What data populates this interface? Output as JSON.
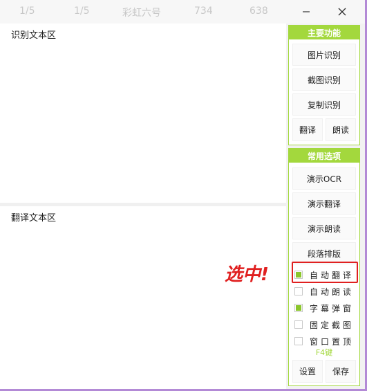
{
  "titlebar": {
    "items": [
      "1/5",
      "1/5",
      "彩虹六号",
      "734",
      "638"
    ],
    "minimize_icon": "minimize-icon",
    "close_icon": "close-icon"
  },
  "recognition_area": {
    "label": "识别文本区"
  },
  "translation_area": {
    "label": "翻译文本区"
  },
  "main_panel": {
    "title": "主要功能",
    "buttons": [
      "图片识别",
      "截图识别",
      "复制识别"
    ],
    "translate": "翻译",
    "read": "朗读"
  },
  "options_panel": {
    "title": "常用选项",
    "buttons": [
      "演示OCR",
      "演示翻译",
      "演示朗读",
      "段落排版"
    ],
    "checkboxes": [
      {
        "label": "自动翻译",
        "checked": true
      },
      {
        "label": "自动朗读",
        "checked": false
      },
      {
        "label": "字幕弹窗",
        "checked": true
      },
      {
        "label": "固定截图",
        "checked": false
      },
      {
        "label": "窗口置顶",
        "checked": false
      }
    ],
    "hotkey": "F4键",
    "settings": "设置",
    "save": "保存"
  },
  "annotation": {
    "text": "选中!",
    "color": "#e02020"
  },
  "colors": {
    "accent": "#a3d83d",
    "check": "#8bc62b",
    "highlight": "#e02020"
  }
}
